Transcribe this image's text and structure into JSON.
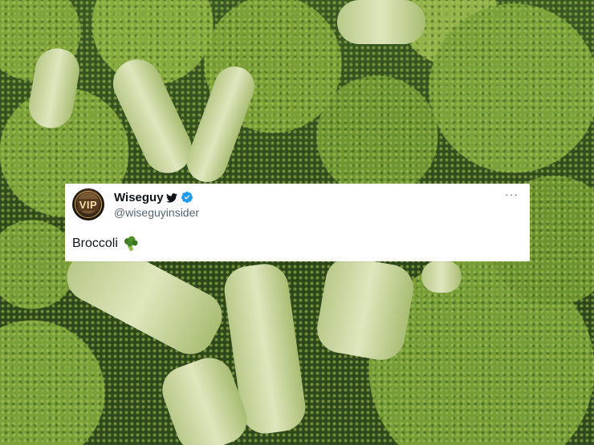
{
  "tweet": {
    "display_name": "Wiseguy",
    "handle": "@wiseguyinsider",
    "avatar_text": "VIP",
    "text": "Broccoli",
    "more_label": "···",
    "icons": {
      "bird": "twitter-bird-icon",
      "verified": "verified-badge-icon",
      "emoji": "broccoli-emoji-icon"
    }
  },
  "colors": {
    "verified": "#1d9bf0",
    "text": "#0f1419",
    "secondary": "#536471"
  }
}
